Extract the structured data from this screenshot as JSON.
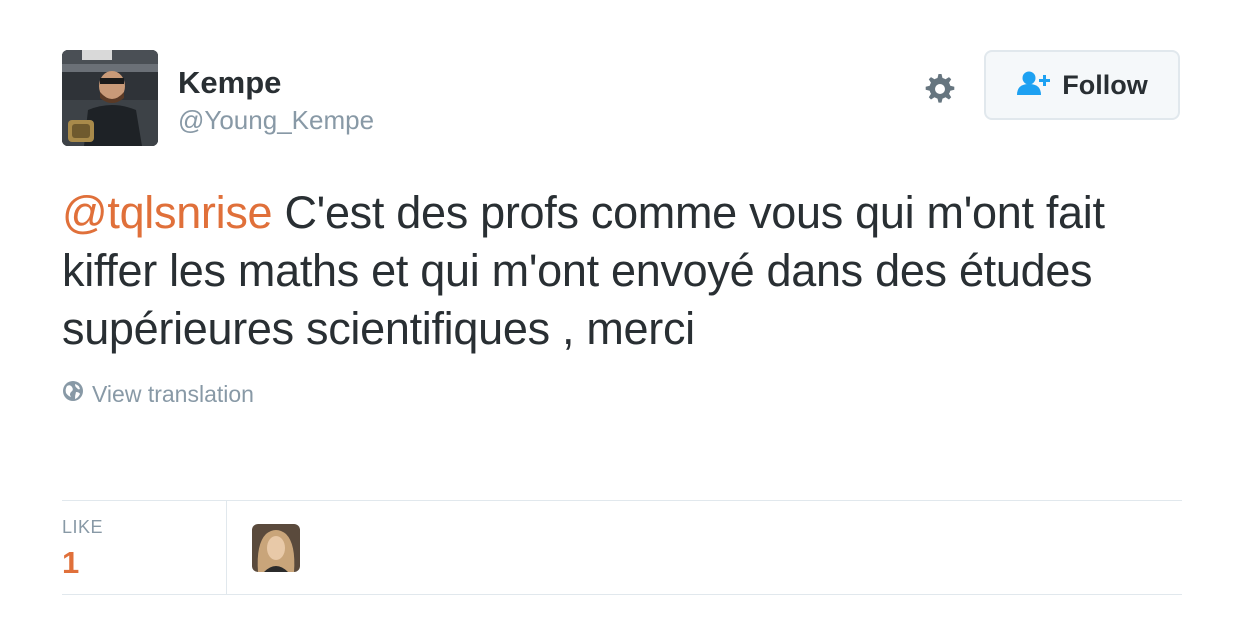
{
  "user": {
    "display_name": "Kempe",
    "screen_name": "@Young_Kempe"
  },
  "actions": {
    "follow_label": "Follow",
    "settings_icon": "gear-icon",
    "follow_icon": "add-user-icon"
  },
  "tweet": {
    "mention": "@tqlsnrise",
    "text": " C'est des profs comme vous qui m'ont fait kiffer les maths et qui m'ont envoyé dans des études supérieures scientifiques , merci",
    "translate_label": "View translation",
    "translate_icon": "globe-icon"
  },
  "stats": {
    "like_label": "LIKE",
    "like_count": "1"
  },
  "colors": {
    "accent": "#e0703a",
    "muted": "#8899a6",
    "text": "#292f33",
    "follow_icon": "#1da1f2",
    "border": "#e1e8ed"
  }
}
